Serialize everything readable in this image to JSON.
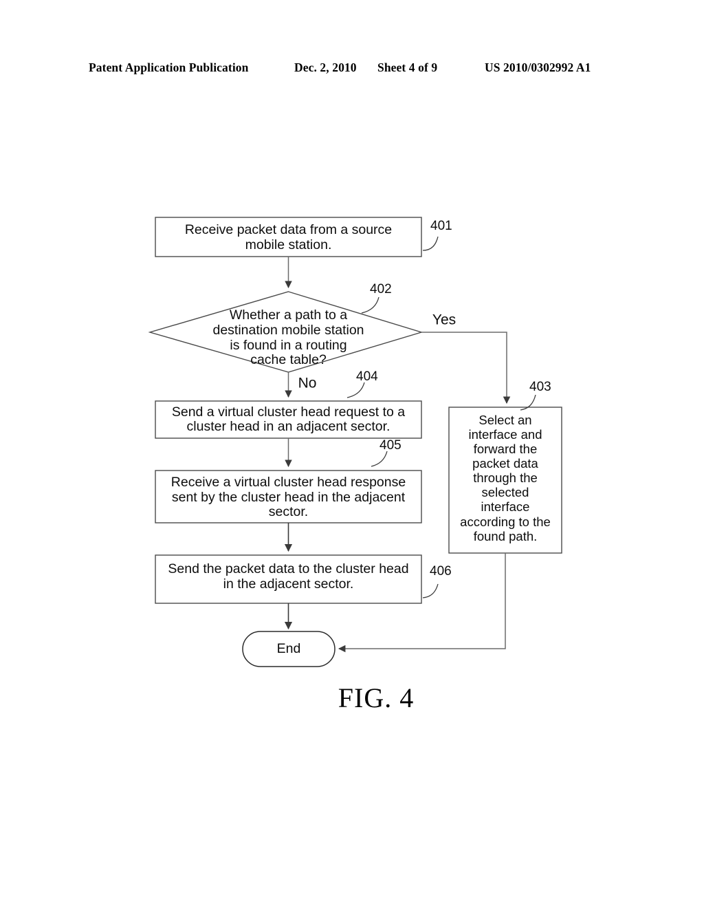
{
  "header": {
    "publication": "Patent Application Publication",
    "date": "Dec. 2, 2010",
    "sheet": "Sheet 4 of 9",
    "patent_number": "US 2010/0302992 A1"
  },
  "figure": {
    "caption": "FIG. 4",
    "nodes": {
      "n401": {
        "ref": "401",
        "type": "process",
        "line1": "Receive packet data from a source",
        "line2": "mobile station."
      },
      "n402": {
        "ref": "402",
        "type": "decision",
        "line1": "Whether a path to a",
        "line2": "destination mobile station",
        "line3": "is found in a routing",
        "line4": "cache table?"
      },
      "n403": {
        "ref": "403",
        "type": "process",
        "line1": "Select an",
        "line2": "interface and",
        "line3": "forward the",
        "line4": "packet data",
        "line5": "through the",
        "line6": "selected",
        "line7": "interface",
        "line8": "according to the",
        "line9": "found path."
      },
      "n404": {
        "ref": "404",
        "type": "process",
        "line1": "Send a virtual cluster head request to a",
        "line2": "cluster head in an adjacent sector."
      },
      "n405": {
        "ref": "405",
        "type": "process",
        "line1": "Receive a virtual cluster head response",
        "line2": "sent by the cluster head in the adjacent",
        "line3": "sector."
      },
      "n406": {
        "ref": "406",
        "type": "process",
        "line1": "Send the packet data to the cluster head",
        "line2": "in the adjacent sector."
      },
      "end": {
        "type": "terminator",
        "label": "End"
      }
    },
    "branch_labels": {
      "yes": "Yes",
      "no": "No"
    }
  },
  "colors": {
    "ink": "#0d0d0d",
    "stroke": "#4a4a4a",
    "connector": "#6b6b6b",
    "page_background": "#ffffff"
  }
}
